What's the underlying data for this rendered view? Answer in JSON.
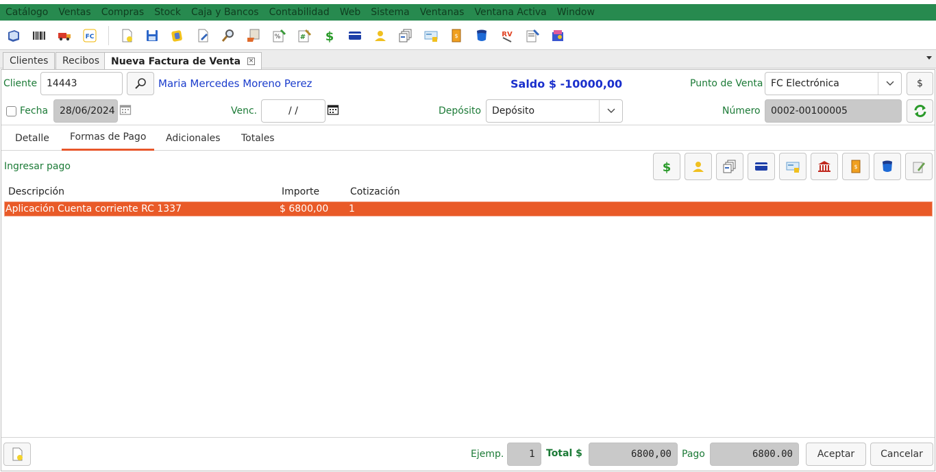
{
  "menu": [
    "Catálogo",
    "Ventas",
    "Compras",
    "Stock",
    "Caja y Bancos",
    "Contabilidad",
    "Web",
    "Sistema",
    "Ventanas",
    "Ventana Activa",
    "Window"
  ],
  "toolbar_icons": [
    "book-icon",
    "barcode-icon",
    "truck-icon",
    "fc-icon",
    "new-doc-icon",
    "save-icon",
    "yellow-doc-icon",
    "edit-doc-icon",
    "magnifier-icon",
    "receipt-icon",
    "percent-icon",
    "hash-edit-icon",
    "dollar-icon",
    "card-icon",
    "person-icon",
    "cheques-icon",
    "transfer-icon",
    "ticket-icon",
    "shield-icon",
    "rv-icon",
    "notes-icon",
    "box-icon"
  ],
  "tabs": [
    {
      "label": "Clientes"
    },
    {
      "label": "Recibos"
    },
    {
      "label": "Nueva Factura de Venta",
      "active": true
    }
  ],
  "header": {
    "cliente_label": "Cliente",
    "cliente_value": "14443",
    "cliente_name": "Maria Mercedes Moreno Perez",
    "saldo": "Saldo $ -10000,00",
    "punto_venta_label": "Punto de Venta",
    "punto_venta_value": "FC Electrónica",
    "dollar_button": "$",
    "fecha_label": "Fecha",
    "fecha_value": "28/06/2024",
    "venc_label": "Venc.",
    "venc_value": "/ /",
    "deposito_label": "Depósito",
    "deposito_value": "Depósito",
    "numero_label": "Número",
    "numero_value": "0002-00100005"
  },
  "inner_tabs": [
    {
      "label": "Detalle"
    },
    {
      "label": "Formas de Pago",
      "active": true
    },
    {
      "label": "Adicionales"
    },
    {
      "label": "Totales"
    }
  ],
  "payments": {
    "ingresar_label": "Ingresar pago",
    "buttons": [
      "dollar-icon",
      "person-icon",
      "cheques-icon",
      "card-icon",
      "transfer-icon",
      "bank-icon",
      "ticket-icon",
      "shield-icon",
      "edit-icon"
    ],
    "columns": [
      "Descripción",
      "Importe",
      "Cotización"
    ],
    "rows": [
      {
        "descripcion": "Aplicación Cuenta corriente RC 1337",
        "importe": "$ 6800,00",
        "cotizacion": "1"
      }
    ]
  },
  "footer": {
    "ejemp_label": "Ejemp.",
    "ejemp_value": "1",
    "total_label": "Total $",
    "total_value": "6800,00",
    "pago_label": "Pago",
    "pago_value": "6800.00",
    "aceptar": "Aceptar",
    "cancelar": "Cancelar"
  },
  "colors": {
    "menu_bg": "#278a4f",
    "accent": "#e95a28",
    "label_green": "#1b7a36",
    "client_blue": "#1a3ccc"
  }
}
